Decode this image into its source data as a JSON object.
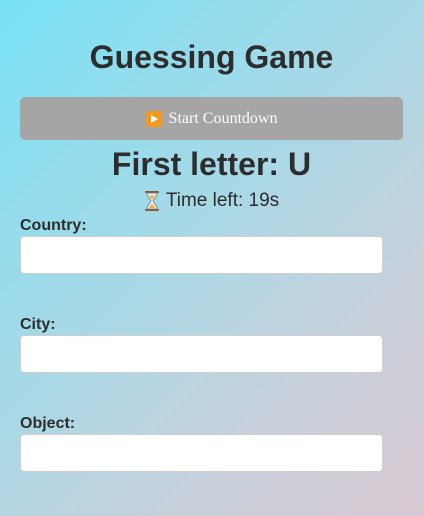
{
  "header": {
    "title": "Guessing Game"
  },
  "controls": {
    "start_label": "Start Countdown",
    "start_icon": "play-button-icon"
  },
  "game": {
    "first_letter_text": "First letter: U",
    "timer_text": "Time left: 19s",
    "timer_icon": "hourglass-icon"
  },
  "fields": [
    {
      "label": "Country:",
      "value": "",
      "placeholder": ""
    },
    {
      "label": "City:",
      "value": "",
      "placeholder": ""
    },
    {
      "label": "Object:",
      "value": "",
      "placeholder": ""
    }
  ],
  "colors": {
    "button_bg": "#a5a5a5",
    "play_icon": "#f39a1e",
    "text": "#2d2d2d"
  }
}
